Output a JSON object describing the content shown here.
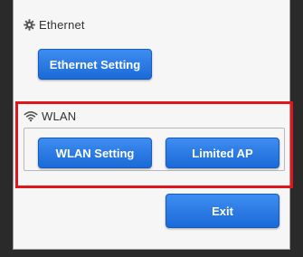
{
  "ethernet_group": {
    "title": "Ethernet",
    "icon": "gear-icon",
    "setting_button": "Ethernet Setting"
  },
  "wlan_group": {
    "title": "WLAN",
    "icon": "wifi-icon",
    "setting_button": "WLAN Setting",
    "limited_ap_button": "Limited AP"
  },
  "exit_button": "Exit",
  "colors": {
    "button": "#1f6fdb",
    "highlight": "#e1161d"
  }
}
